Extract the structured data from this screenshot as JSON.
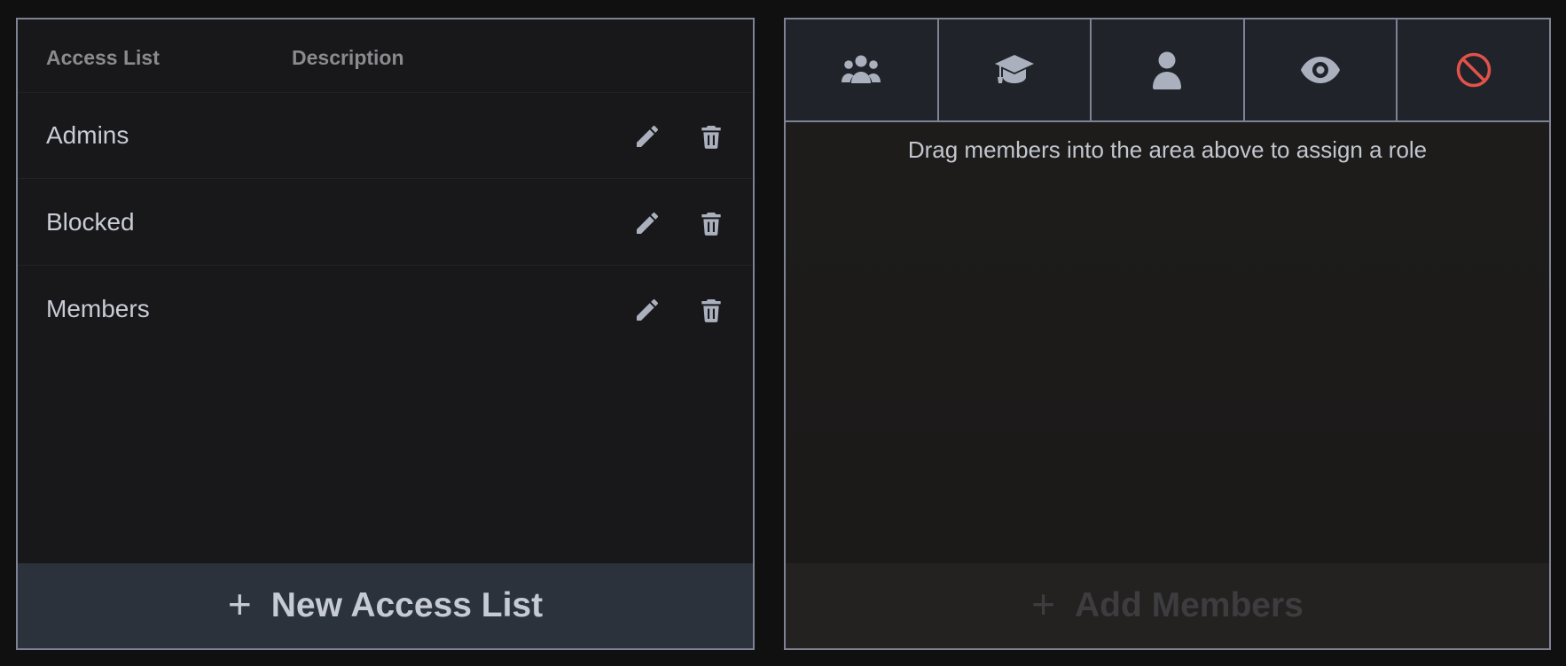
{
  "access_lists": {
    "columns": {
      "name": "Access List",
      "description": "Description"
    },
    "rows": [
      {
        "name": "Admins",
        "description": ""
      },
      {
        "name": "Blocked",
        "description": ""
      },
      {
        "name": "Members",
        "description": ""
      }
    ],
    "new_button": {
      "icon": "plus-icon",
      "label": "New Access List"
    }
  },
  "roles": {
    "slots": [
      {
        "icon": "users-group-icon"
      },
      {
        "icon": "graduation-cap-icon"
      },
      {
        "icon": "user-icon"
      },
      {
        "icon": "eye-icon"
      },
      {
        "icon": "ban-icon",
        "color": "#e0524a"
      }
    ],
    "hint": "Drag members into the area above to assign a role",
    "add_button": {
      "icon": "plus-icon",
      "label": "Add Members"
    }
  },
  "colors": {
    "icon": "#aab0bd",
    "ban": "#e0524a",
    "border": "#7e8294"
  }
}
